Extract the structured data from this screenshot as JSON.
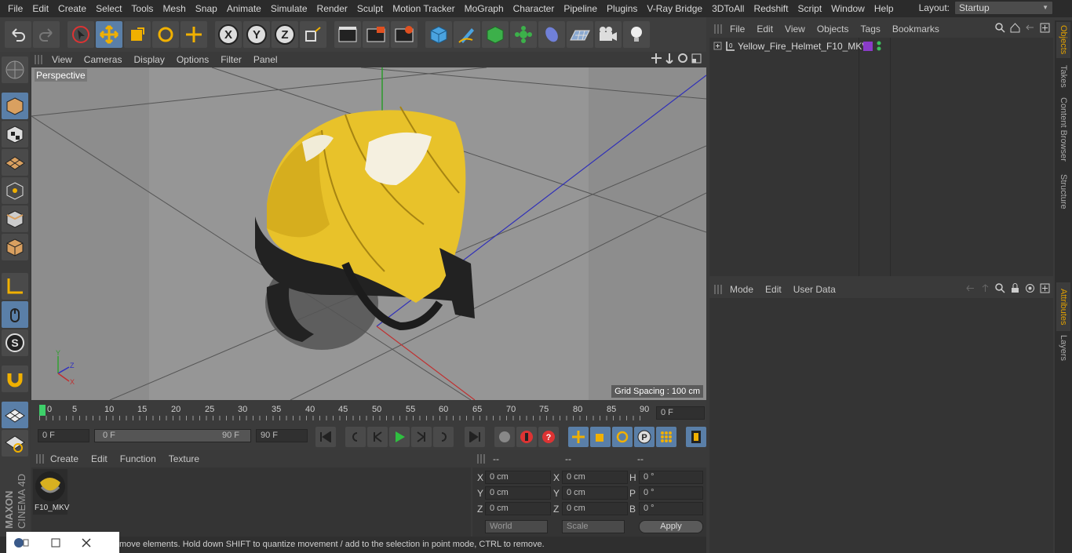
{
  "menubar": {
    "items": [
      "File",
      "Edit",
      "Create",
      "Select",
      "Tools",
      "Mesh",
      "Snap",
      "Animate",
      "Simulate",
      "Render",
      "Sculpt",
      "Motion Tracker",
      "MoGraph",
      "Character",
      "Pipeline",
      "Plugins",
      "V-Ray Bridge",
      "3DToAll",
      "Redshift",
      "Script",
      "Window",
      "Help"
    ],
    "layout_label": "Layout:",
    "layout_value": "Startup"
  },
  "toolbar": {
    "icons": [
      "undo-icon",
      "redo-icon",
      "select-icon",
      "move-icon",
      "scale-icon",
      "rotate-icon",
      "live-select-icon",
      "x-axis-icon",
      "y-axis-icon",
      "z-axis-icon",
      "coordinate-system-icon",
      "render-view-icon",
      "render-picture-viewer-icon",
      "render-settings-icon",
      "cube-icon",
      "pen-icon",
      "subdivision-icon",
      "cloner-icon",
      "deformer-icon",
      "floor-icon",
      "camera-icon",
      "light-icon"
    ],
    "axis_labels": [
      "X",
      "Y",
      "Z"
    ]
  },
  "viewport": {
    "menu": [
      "View",
      "Cameras",
      "Display",
      "Options",
      "Filter",
      "Panel"
    ],
    "label": "Perspective",
    "grid_spacing": "Grid Spacing : 100 cm"
  },
  "timeline": {
    "ticks": [
      "0",
      "5",
      "10",
      "15",
      "20",
      "25",
      "30",
      "35",
      "40",
      "45",
      "50",
      "55",
      "60",
      "65",
      "70",
      "75",
      "80",
      "85",
      "90"
    ],
    "current_frame": "0 F"
  },
  "transport": {
    "start": "0 F",
    "range_start": "0 F",
    "range_end": "90 F",
    "end": "90 F"
  },
  "material_manager": {
    "menu": [
      "Create",
      "Edit",
      "Function",
      "Texture"
    ],
    "material_name": "F10_MKV"
  },
  "coordinates": {
    "headers": [
      "--",
      "--",
      "--"
    ],
    "rows": [
      {
        "l1": "X",
        "v1": "0 cm",
        "l2": "X",
        "v2": "0 cm",
        "l3": "H",
        "v3": "0 °"
      },
      {
        "l1": "Y",
        "v1": "0 cm",
        "l2": "Y",
        "v2": "0 cm",
        "l3": "P",
        "v3": "0 °"
      },
      {
        "l1": "Z",
        "v1": "0 cm",
        "l2": "Z",
        "v2": "0 cm",
        "l3": "B",
        "v3": "0 °"
      }
    ],
    "mode": "World",
    "scale": "Scale",
    "apply": "Apply"
  },
  "status": "move elements. Hold down SHIFT to quantize movement / add to the selection in point mode, CTRL to remove.",
  "object_manager": {
    "menu": [
      "File",
      "Edit",
      "View",
      "Objects",
      "Tags",
      "Bookmarks"
    ],
    "object_name": "Yellow_Fire_Helmet_F10_MKV"
  },
  "attribute_manager": {
    "menu": [
      "Mode",
      "Edit",
      "User Data"
    ]
  },
  "right_tabs": [
    "Objects",
    "Takes",
    "Content Browser",
    "Structure",
    "Attributes",
    "Layers"
  ],
  "brand": {
    "line1": "MAXON",
    "line2": "CINEMA 4D"
  },
  "colors": {
    "accent": "#5a7fa8",
    "helmet": "#e8c22a",
    "tab_active": "#e0a000"
  }
}
